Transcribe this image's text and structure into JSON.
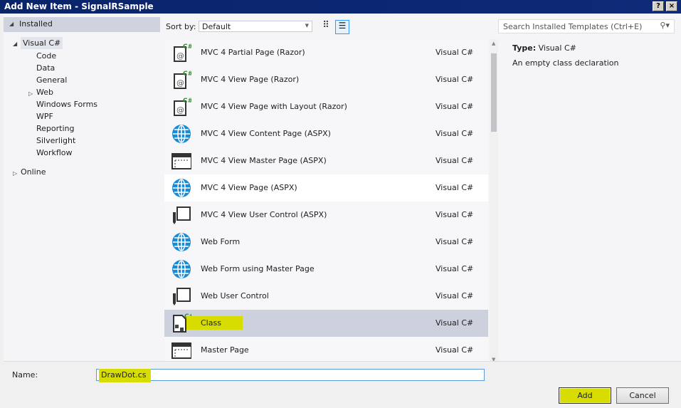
{
  "title": "Add New Item - SignalRSample",
  "title_buttons": {
    "help": "?",
    "close": "×"
  },
  "sidebar": {
    "installed": "Installed",
    "visual_csharp": "Visual C#",
    "children": [
      "Code",
      "Data",
      "General",
      "Web",
      "Windows Forms",
      "WPF",
      "Reporting",
      "Silverlight",
      "Workflow"
    ],
    "online": "Online"
  },
  "sort": {
    "label": "Sort by:",
    "value": "Default"
  },
  "search": {
    "placeholder": "Search Installed Templates (Ctrl+E)"
  },
  "templates": [
    {
      "name": "MVC 4 Partial Page (Razor)",
      "lang": "Visual C#",
      "icon": "razor"
    },
    {
      "name": "MVC 4 View Page (Razor)",
      "lang": "Visual C#",
      "icon": "razor"
    },
    {
      "name": "MVC 4 View Page with Layout (Razor)",
      "lang": "Visual C#",
      "icon": "razor"
    },
    {
      "name": "MVC 4 View Content Page (ASPX)",
      "lang": "Visual C#",
      "icon": "globe"
    },
    {
      "name": "MVC 4 View Master Page (ASPX)",
      "lang": "Visual C#",
      "icon": "master"
    },
    {
      "name": "MVC 4 View Page (ASPX)",
      "lang": "Visual C#",
      "icon": "globe"
    },
    {
      "name": "MVC 4 View User Control (ASPX)",
      "lang": "Visual C#",
      "icon": "control"
    },
    {
      "name": "Web Form",
      "lang": "Visual C#",
      "icon": "globe"
    },
    {
      "name": "Web Form using Master Page",
      "lang": "Visual C#",
      "icon": "globe"
    },
    {
      "name": "Web User Control",
      "lang": "Visual C#",
      "icon": "control"
    },
    {
      "name": "Class",
      "lang": "Visual C#",
      "icon": "class"
    },
    {
      "name": "Master Page",
      "lang": "Visual C#",
      "icon": "master"
    }
  ],
  "selected_index": 10,
  "details": {
    "type_label": "Type:",
    "type_value": "Visual C#",
    "description": "An empty class declaration"
  },
  "name_field": {
    "label": "Name:",
    "value": "DrawDot.cs"
  },
  "buttons": {
    "add": "Add",
    "cancel": "Cancel"
  },
  "colors": {
    "title": "#0a246a",
    "selected": "#cdd1dd",
    "highlight": "#d7dd00",
    "globe": "#1b8ad6"
  }
}
